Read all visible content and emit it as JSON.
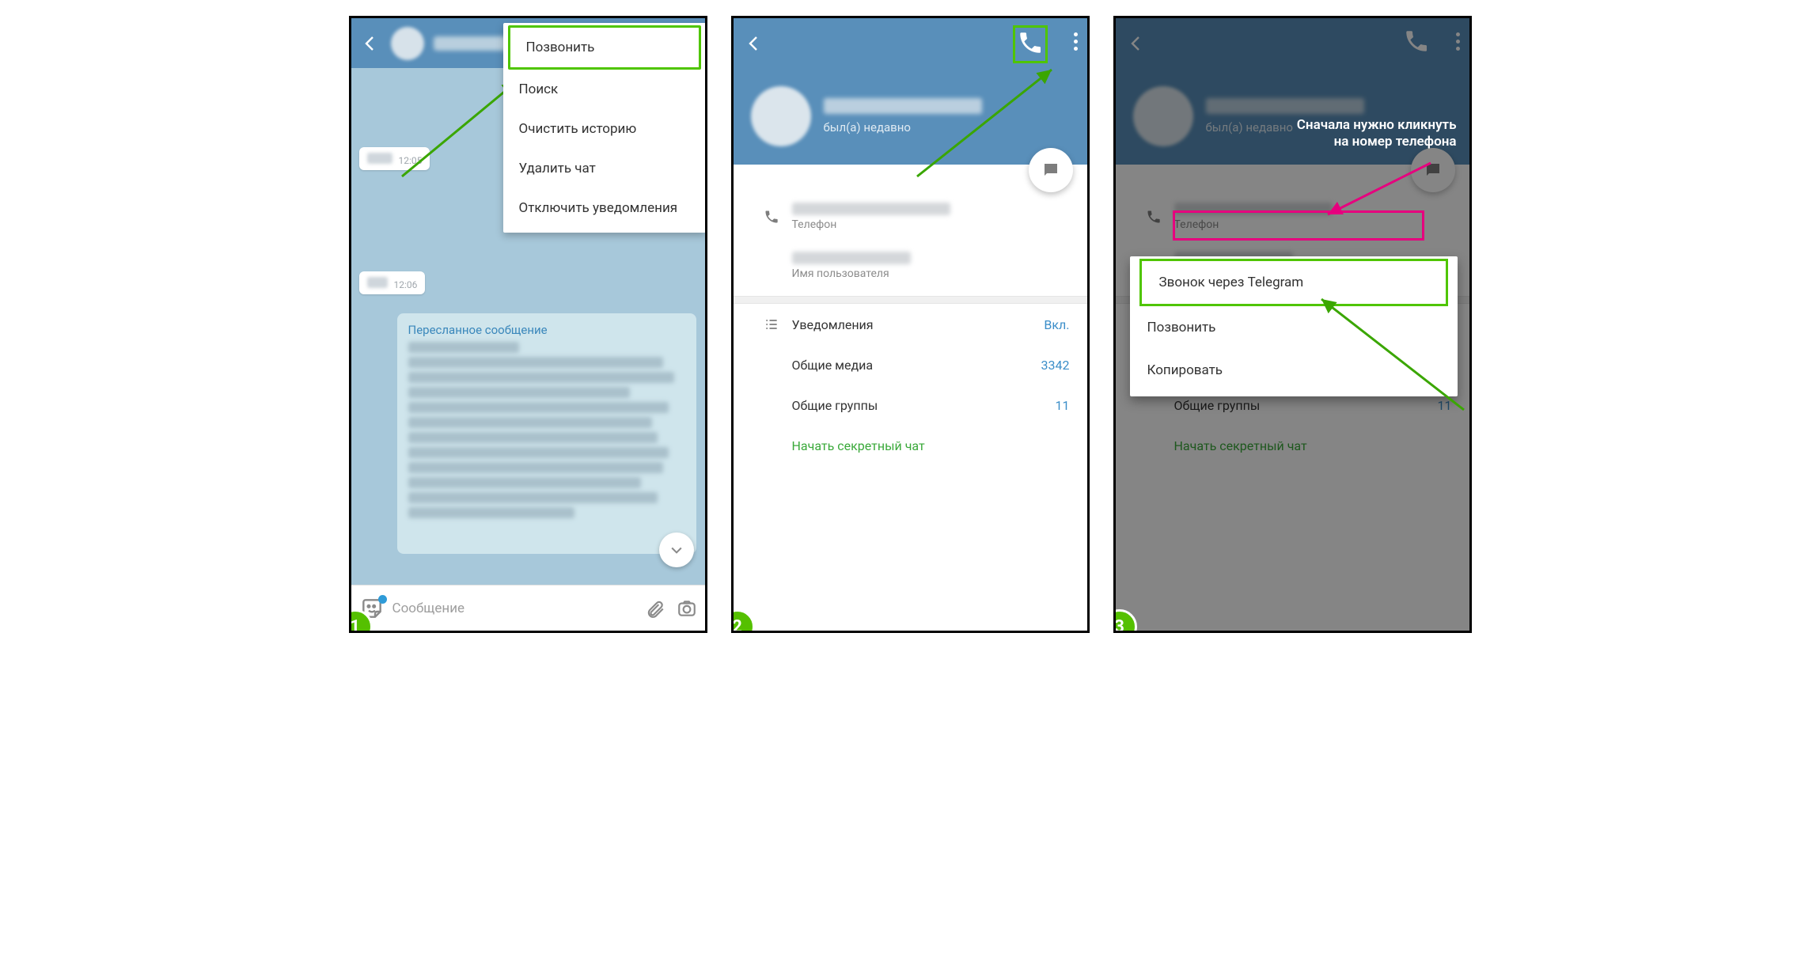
{
  "badges": {
    "one": "1",
    "two": "2",
    "three": "3"
  },
  "screen1": {
    "menu": {
      "call": "Позвонить",
      "search": "Поиск",
      "clear": "Очистить историю",
      "delete": "Удалить чат",
      "mute": "Отключить уведомления"
    },
    "msg_time_1": "12:05",
    "msg_time_2": "12:06",
    "forwarded_title": "Пересланное сообщение",
    "input_placeholder": "Сообщение"
  },
  "profile": {
    "status": "был(а) недавно",
    "phone_label": "Телефон",
    "username_label": "Имя пользователя",
    "notifications_label": "Уведомления",
    "notifications_value": "Вкл.",
    "media_label": "Общие медиа",
    "media_value": "3342",
    "groups_label": "Общие группы",
    "groups_value": "11",
    "secret_chat": "Начать секретный чат"
  },
  "screen3": {
    "note": "Сначала нужно кликнуть на номер телефона",
    "ctx": {
      "telegram_call": "Звонок через Telegram",
      "call": "Позвонить",
      "copy": "Копировать"
    }
  }
}
